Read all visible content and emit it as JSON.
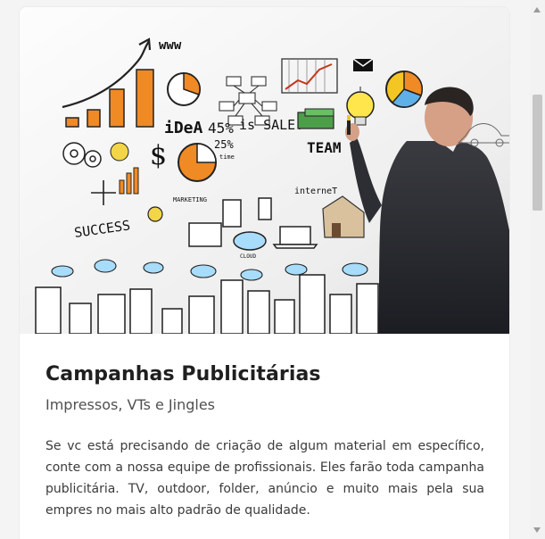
{
  "card": {
    "title": "Campanhas Publicitárias",
    "subtitle": "Impressos, VTs e Jingles",
    "description": "Se vc está precisando de criação de algum material em específico, conte com a nossa equipe de profissionais. Eles farão toda campanha publicitária. TV, outdoor, folder, anúncio e muito mais pela sua empres no mais alto padrão de qualidade."
  },
  "hero_image": {
    "labels": {
      "www": "www",
      "idea": "iDeA",
      "percent": "45%",
      "sale": "is SALE!",
      "team": "TEAM",
      "internet": "interneT",
      "success": "SUCCESS",
      "marketing": "MARKETING",
      "cloud": "CLOUD",
      "time": "25%",
      "time_sub": "time",
      "dollar": "$"
    }
  },
  "scrollbar": {
    "icons": [
      "chevron-up-icon",
      "chevron-down-icon"
    ]
  }
}
